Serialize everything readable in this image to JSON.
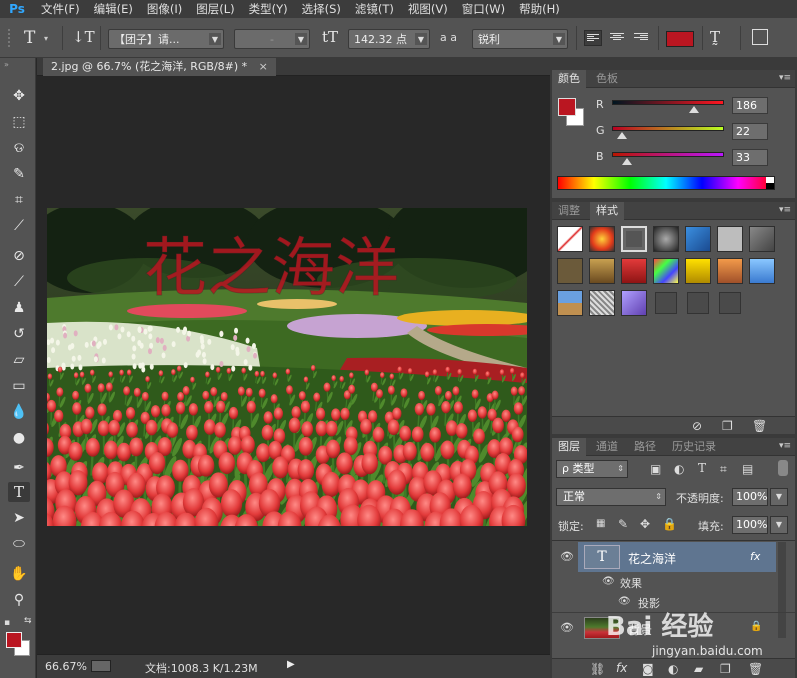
{
  "app": {
    "logo": "Ps",
    "menu": [
      "文件(F)",
      "编辑(E)",
      "图像(I)",
      "图层(L)",
      "类型(Y)",
      "选择(S)",
      "滤镜(T)",
      "视图(V)",
      "窗口(W)",
      "帮助(H)"
    ]
  },
  "options": {
    "font_family": "【团子】请...",
    "font_style": "-",
    "font_size": "142.32 点",
    "aa_label": "a a",
    "antialias": "锐利",
    "text_color": "#ba1621"
  },
  "document": {
    "tab_title": "2.jpg @ 66.7% (花之海洋, RGB/8#) *",
    "close": "×",
    "canvas_text": "花之海洋",
    "zoom": "66.67%",
    "doc_info": "文档:1008.3 K/1.23M"
  },
  "color_panel": {
    "tabs": [
      "颜色",
      "色板"
    ],
    "channels": [
      {
        "label": "R",
        "value": "186",
        "fraction": 0.73
      },
      {
        "label": "G",
        "value": "22",
        "fraction": 0.09
      },
      {
        "label": "B",
        "value": "33",
        "fraction": 0.13
      }
    ],
    "fg": "#ba1621",
    "bg": "#ffffff"
  },
  "styles_panel": {
    "tabs": [
      "调整",
      "样式"
    ]
  },
  "layers_panel": {
    "tabs": [
      "图层",
      "通道",
      "路径",
      "历史记录"
    ],
    "filter_label": "ρ 类型",
    "blend_mode": "正常",
    "opacity_label": "不透明度:",
    "opacity": "100%",
    "lock_label": "锁定:",
    "fill_label": "填充:",
    "fill": "100%",
    "layers": [
      {
        "name": "花之海洋",
        "fx": "fx"
      },
      {
        "name": "效果"
      },
      {
        "name": "投影"
      },
      {
        "name": "背景"
      }
    ]
  },
  "watermark": {
    "text": "Bai 经验",
    "url": "jingyan.baidu.com"
  },
  "colors": {
    "accent": "#31a8ff",
    "text_red": "#ba1621",
    "layer_selected": "#5f7590"
  }
}
